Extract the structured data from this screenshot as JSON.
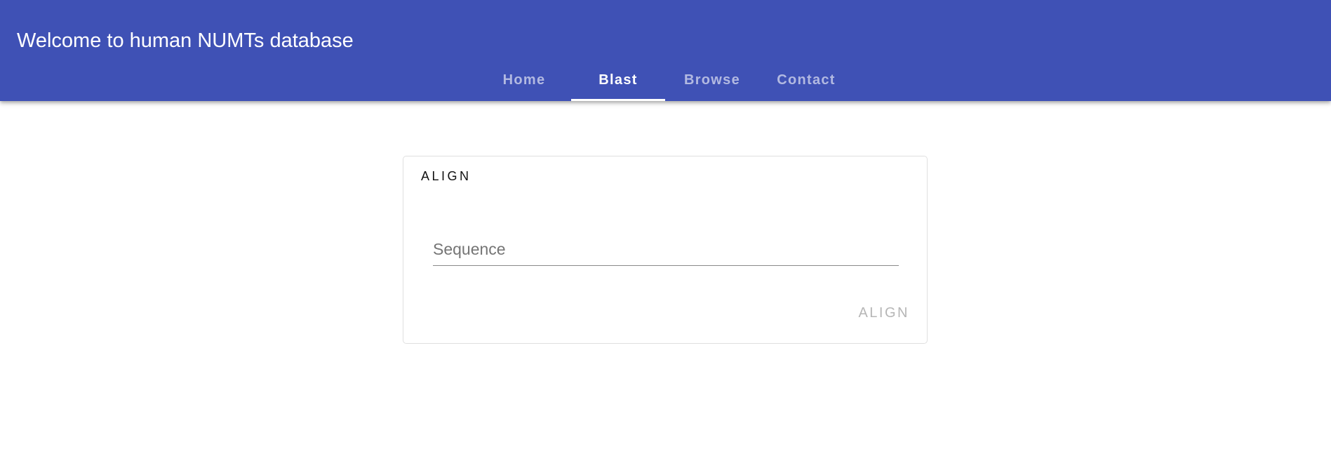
{
  "header": {
    "title": "Welcome to human NUMTs database",
    "background": "#3f51b5"
  },
  "tabs": [
    {
      "label": "Home",
      "active": false
    },
    {
      "label": "Blast",
      "active": true
    },
    {
      "label": "Browse",
      "active": false
    },
    {
      "label": "Contact",
      "active": false
    }
  ],
  "card": {
    "title": "ALIGN",
    "sequence_placeholder": "Sequence",
    "sequence_value": "",
    "align_button_label": "ALIGN",
    "align_button_enabled": false
  }
}
